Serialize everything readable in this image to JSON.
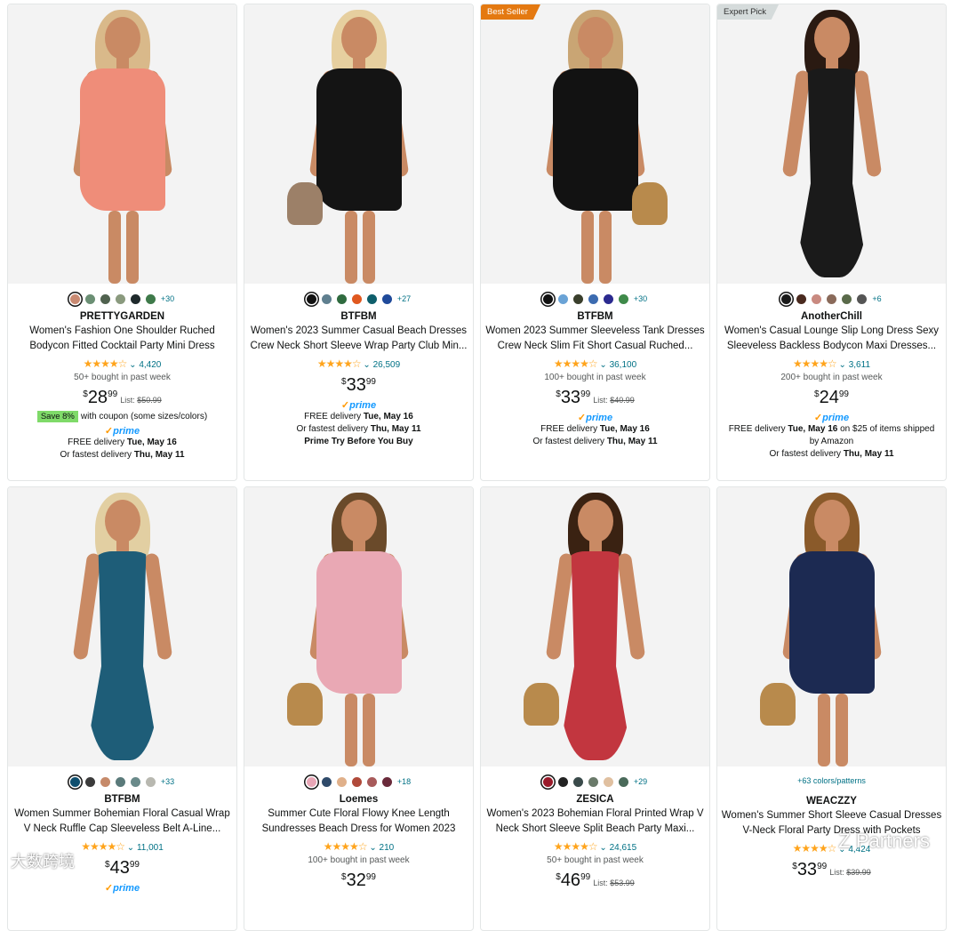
{
  "row1": [
    {
      "badge": "",
      "brand": "PRETTYGARDEN",
      "title": "Women's Fashion One Shoulder Ruched Bodycon Fitted Cocktail Party Mini Dress",
      "stars": "★★★★☆",
      "reviews": "4,420",
      "bought": "50+ bought in past week",
      "price_cur": "$",
      "price_whole": "28",
      "price_frac": "99",
      "list_label": "List:",
      "list_price": "$50.99",
      "coupon_tag": "Save 8%",
      "coupon_text": "with coupon (some sizes/colors)",
      "prime": "prime",
      "lines": [
        {
          "pre": "FREE delivery ",
          "bold": "Tue, May 16",
          "post": ""
        },
        {
          "pre": "Or fastest delivery ",
          "bold": "Thu, May 11",
          "post": ""
        }
      ],
      "more_colors": "+30",
      "swatches": [
        "#c98a72",
        "#6b8f74",
        "#50624f",
        "#8a9a7e",
        "#1f2a2c",
        "#3f7a4a"
      ],
      "dress_color": "#ef8d79",
      "hair_color": "#d9b98a"
    },
    {
      "badge": "",
      "brand": "BTFBM",
      "title": "Women's 2023 Summer Casual Beach Dresses Crew Neck Short Sleeve Wrap Party Club Min...",
      "stars": "★★★★☆",
      "reviews": "26,509",
      "bought": "",
      "price_cur": "$",
      "price_whole": "33",
      "price_frac": "99",
      "list_label": "",
      "list_price": "",
      "coupon_tag": "",
      "coupon_text": "",
      "prime": "prime",
      "lines": [
        {
          "pre": "FREE delivery ",
          "bold": "Tue, May 16",
          "post": ""
        },
        {
          "pre": "Or fastest delivery ",
          "bold": "Thu, May 11",
          "post": ""
        },
        {
          "pre": "",
          "bold": "Prime Try Before You Buy",
          "post": ""
        }
      ],
      "more_colors": "+27",
      "swatches": [
        "#111111",
        "#5f7f8f",
        "#2f6b3f",
        "#e0581f",
        "#0e5e6b",
        "#1f4a9a"
      ],
      "dress_color": "#141414",
      "hair_color": "#e6cf9f"
    },
    {
      "badge": "Best Seller",
      "brand": "BTFBM",
      "title": "Women 2023 Summer Sleeveless Tank Dresses Crew Neck Slim Fit Short Casual Ruched...",
      "stars": "★★★★☆",
      "reviews": "36,100",
      "bought": "100+ bought in past week",
      "price_cur": "$",
      "price_whole": "33",
      "price_frac": "99",
      "list_label": "List:",
      "list_price": "$40.99",
      "coupon_tag": "",
      "coupon_text": "",
      "prime": "prime",
      "lines": [
        {
          "pre": "FREE delivery ",
          "bold": "Tue, May 16",
          "post": ""
        },
        {
          "pre": "Or fastest delivery ",
          "bold": "Thu, May 11",
          "post": ""
        }
      ],
      "more_colors": "+30",
      "swatches": [
        "#111111",
        "#6aa3d6",
        "#3a3f2c",
        "#3c6bb0",
        "#2b2a8f",
        "#3f8a4a"
      ],
      "dress_color": "#121212",
      "hair_color": "#c9a574"
    },
    {
      "badge": "Expert Pick",
      "brand": "AnotherChill",
      "title": "Women's Casual Lounge Slip Long Dress Sexy Sleeveless Backless Bodycon Maxi Dresses...",
      "stars": "★★★★☆",
      "reviews": "3,611",
      "bought": "200+ bought in past week",
      "price_cur": "$",
      "price_whole": "24",
      "price_frac": "99",
      "list_label": "",
      "list_price": "",
      "coupon_tag": "",
      "coupon_text": "",
      "prime": "prime",
      "lines": [
        {
          "pre": "FREE delivery ",
          "bold": "Tue, May 16",
          "post": " on $25 of items shipped"
        },
        {
          "pre": "by Amazon",
          "bold": "",
          "post": ""
        },
        {
          "pre": "Or fastest delivery ",
          "bold": "Thu, May 11",
          "post": ""
        }
      ],
      "more_colors": "+6",
      "swatches": [
        "#1a1a1a",
        "#4a2a1f",
        "#c98a80",
        "#8a6a5a",
        "#5a6a4a",
        "#555555"
      ],
      "dress_color": "#1a1a1a",
      "hair_color": "#2a1a12"
    }
  ],
  "row2": [
    {
      "brand": "BTFBM",
      "title": "Women Summer Bohemian Floral Casual Wrap V Neck Ruffle Cap Sleeveless Belt A-Line...",
      "stars": "★★★★☆",
      "reviews": "11,001",
      "bought": "",
      "price_cur": "$",
      "price_whole": "43",
      "price_frac": "99",
      "list_label": "",
      "list_price": "",
      "prime": "prime",
      "more_colors": "+33",
      "colors_text": "",
      "swatches": [
        "#0f4f6f",
        "#3b3b3b",
        "#c68a6a",
        "#5a7a7a",
        "#6a8a8a",
        "#b8b8b0"
      ],
      "dress_color": "#1e5d78",
      "hair_color": "#e2cfa2"
    },
    {
      "brand": "Loemes",
      "title": "Summer Cute Floral Flowy Knee Length Sundresses Beach Dress for Women 2023",
      "stars": "★★★★☆",
      "reviews": "210",
      "bought": "100+ bought in past week",
      "price_cur": "$",
      "price_whole": "32",
      "price_frac": "99",
      "list_label": "",
      "list_price": "",
      "prime": "",
      "more_colors": "+18",
      "colors_text": "",
      "swatches": [
        "#e8a6b6",
        "#2f4a6a",
        "#e0b08a",
        "#b04a3a",
        "#a85a5a",
        "#6a2a3a"
      ],
      "dress_color": "#e9a8b4",
      "hair_color": "#6a4a2a"
    },
    {
      "brand": "ZESICA",
      "title": "Women's 2023 Bohemian Floral Printed Wrap V Neck Short Sleeve Split Beach Party Maxi...",
      "stars": "★★★★☆",
      "reviews": "24,615",
      "bought": "50+ bought in past week",
      "price_cur": "$",
      "price_whole": "46",
      "price_frac": "99",
      "list_label": "List:",
      "list_price": "$53.99",
      "prime": "",
      "more_colors": "+29",
      "colors_text": "",
      "swatches": [
        "#9a1a2a",
        "#222222",
        "#3a4a4a",
        "#6a7a6a",
        "#e0c0a0",
        "#4a6a5a"
      ],
      "dress_color": "#c2363f",
      "hair_color": "#3a2212"
    },
    {
      "brand": "WEACZZY",
      "title": "Women's Summer Short Sleeve Casual Dresses V-Neck Floral Party Dress with Pockets",
      "stars": "★★★★☆",
      "reviews": "4,424",
      "bought": "",
      "price_cur": "$",
      "price_whole": "33",
      "price_frac": "99",
      "list_label": "List:",
      "list_price": "$39.99",
      "prime": "",
      "more_colors": "",
      "colors_text": "+63 colors/patterns",
      "swatches": [],
      "dress_color": "#1c2a52",
      "hair_color": "#8a5a2a"
    }
  ],
  "watermark_left": "大数跨境",
  "watermark_right": "Z Partners"
}
